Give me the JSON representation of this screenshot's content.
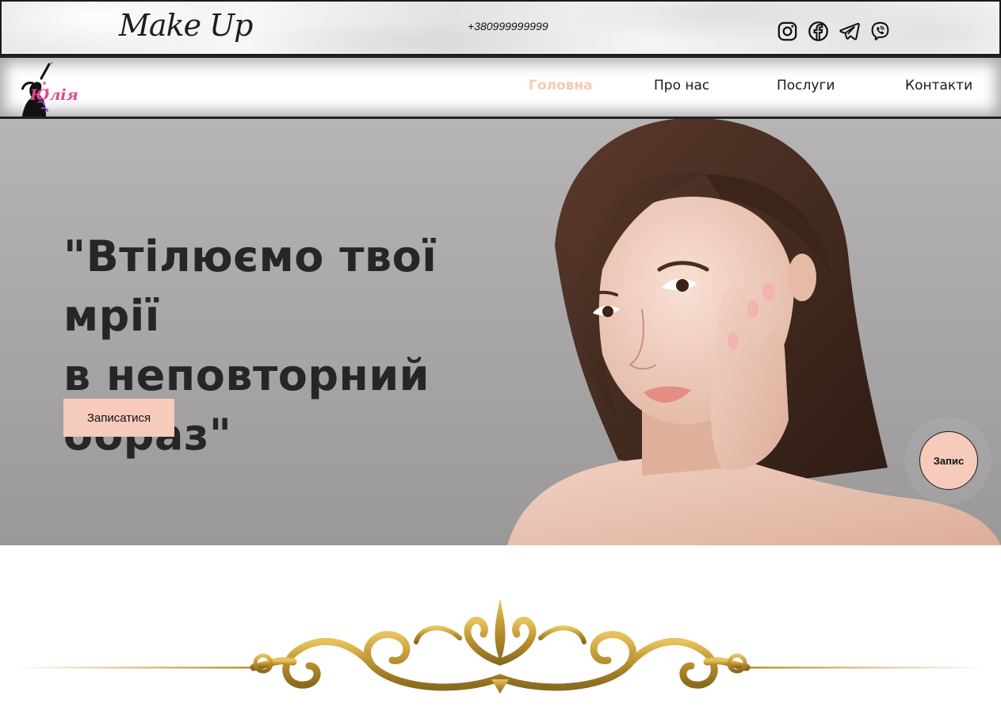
{
  "topbar": {
    "brand": "Make Up",
    "phone": "+380999999999",
    "socials": [
      {
        "icon": "instagram-icon"
      },
      {
        "icon": "facebook-icon"
      },
      {
        "icon": "telegram-icon"
      },
      {
        "icon": "viber-icon"
      }
    ]
  },
  "nav": {
    "logo_text": "Юлія",
    "links": [
      {
        "label": "Головна",
        "active": true
      },
      {
        "label": "Про нас",
        "active": false
      },
      {
        "label": "Послуги",
        "active": false
      },
      {
        "label": "Контакти",
        "active": false
      }
    ]
  },
  "hero": {
    "title_line1": "\"Втілюємо твої мрії",
    "title_line2": "в неповторний",
    "title_line3": "образ\"",
    "cta_label": "Записатися",
    "fab_label": "Запис"
  },
  "colors": {
    "accent": "#f6cbbb",
    "nav_active": "#f6c8b6",
    "logo_pink": "#e2468d",
    "ornament_gold": "#b8902e"
  }
}
